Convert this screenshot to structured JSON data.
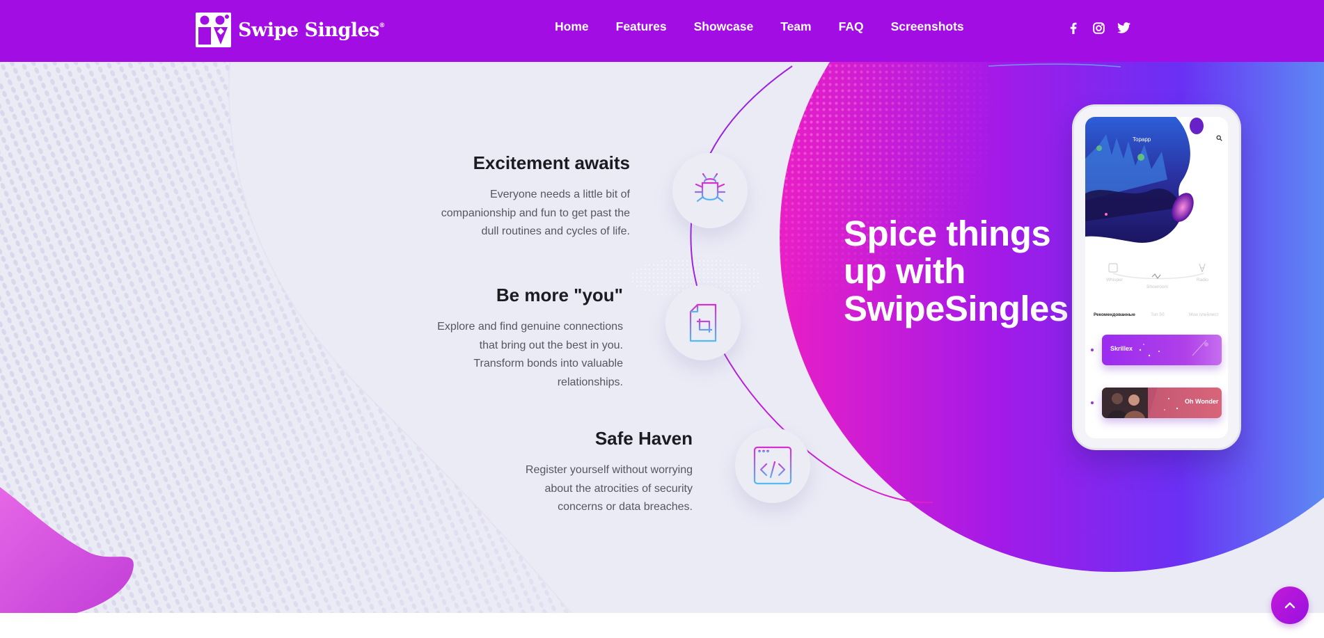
{
  "brand": {
    "name": "Swipe Singles",
    "reg": "®"
  },
  "nav": [
    {
      "label": "Home"
    },
    {
      "label": "Features"
    },
    {
      "label": "Showcase"
    },
    {
      "label": "Team"
    },
    {
      "label": "FAQ"
    },
    {
      "label": "Screenshots"
    }
  ],
  "social": [
    {
      "icon": "facebook-icon"
    },
    {
      "icon": "instagram-icon"
    },
    {
      "icon": "twitter-icon"
    }
  ],
  "features": [
    {
      "title": "Excitement awaits",
      "lines": [
        "Everyone needs a little bit of",
        "companionship and fun to get past the",
        "dull routines and cycles of life."
      ],
      "icon": "bug-icon"
    },
    {
      "title": "Be more \"you\"",
      "lines": [
        "Explore and find genuine connections",
        "that bring out the best in you.",
        "Transform bonds into valuable",
        "relationships."
      ],
      "icon": "crop-icon"
    },
    {
      "title": "Safe Haven",
      "lines": [
        "Register yourself without worrying",
        "about the atrocities of security",
        "concerns or data breaches."
      ],
      "icon": "code-window-icon"
    }
  ],
  "hero": {
    "headline": [
      "Spice things",
      "up with",
      "SwipeSingles"
    ]
  },
  "phone": {
    "app_title": "Topapp",
    "modes": [
      "Whisper",
      "Showroom",
      "Radio"
    ],
    "tabs": [
      "Рекомендованные",
      "Топ 50",
      "Мои плейлист"
    ],
    "tracks": [
      {
        "name": "Skrillex"
      },
      {
        "name": "Oh Wonder"
      }
    ]
  },
  "colors": {
    "header": "#a20de3",
    "hero_bg": "#ebebf6",
    "accent_magenta": "#e61ec8",
    "accent_violet": "#7b22f2",
    "accent_cyan": "#4fe3ea"
  },
  "scroll_top": {
    "icon": "chevron-up-icon"
  }
}
